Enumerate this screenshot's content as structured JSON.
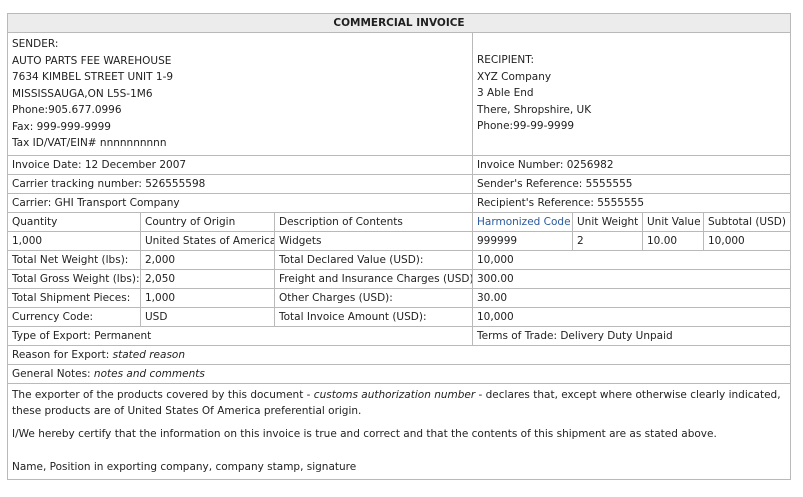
{
  "title": "COMMERCIAL INVOICE",
  "sender": {
    "lines": [
      "SENDER:",
      "AUTO PARTS FEE WAREHOUSE",
      "7634 KIMBEL STREET UNIT 1-9",
      "MISSISSAUGA,ON L5S-1M6",
      "Phone:905.677.0996",
      "Fax: 999-999-9999",
      "Tax ID/VAT/EIN# nnnnnnnnnn"
    ]
  },
  "recipient": {
    "lines": [
      "RECIPIENT:",
      "XYZ Company",
      "3 Able End",
      "There, Shropshire, UK",
      "Phone:99-99-9999"
    ]
  },
  "info": {
    "invoice_date": "Invoice Date: 12 December 2007",
    "invoice_number": "Invoice Number: 0256982",
    "carrier_tracking": "Carrier tracking number: 526555598",
    "sender_reference": "Sender's Reference: 5555555",
    "carrier": "Carrier: GHI Transport Company",
    "recipient_reference": "Recipient's Reference: 5555555"
  },
  "items": {
    "headers": {
      "quantity": "Quantity",
      "country": "Country of Origin",
      "description": "Description of Contents",
      "harmonized": "Harmonized Code",
      "unit_weight": "Unit Weight",
      "unit_value": "Unit Value",
      "subtotal": "Subtotal (USD)"
    },
    "row": {
      "quantity": "1,000",
      "country": "United States of America",
      "description": "Widgets",
      "harmonized": "999999",
      "unit_weight": "2",
      "unit_value": "10.00",
      "subtotal": "10,000"
    }
  },
  "totals": {
    "net_weight_label": "Total Net Weight (lbs):",
    "net_weight_value": "2,000",
    "declared_value_label": "Total Declared Value (USD):",
    "declared_value_value": "10,000",
    "gross_weight_label": "Total Gross Weight (lbs):",
    "gross_weight_value": "2,050",
    "freight_label": "Freight and Insurance Charges (USD):",
    "freight_value": "300.00",
    "shipment_pieces_label": "Total Shipment Pieces:",
    "shipment_pieces_value": "1,000",
    "other_charges_label": "Other Charges (USD):",
    "other_charges_value": "30.00",
    "currency_label": "Currency Code:",
    "currency_value": "USD",
    "invoice_amount_label": "Total Invoice Amount (USD):",
    "invoice_amount_value": "10,000"
  },
  "export": {
    "type": "Type of Export: Permanent",
    "terms": "Terms of Trade: Delivery Duty Unpaid",
    "reason_label": "Reason for Export: ",
    "reason_value": "stated reason",
    "notes_label": "General Notes: ",
    "notes_value": "notes and comments"
  },
  "declaration": {
    "part1": "The exporter of the products covered by this document - ",
    "auth_number": "customs authorization number",
    "part2": " - declares that, except where otherwise clearly indicated, these products are of United States Of America preferential origin.",
    "certify": "I/We hereby certify that the information on this invoice is true and correct and that the contents of this shipment are as stated above.",
    "signature": "Name, Position in exporting company, company stamp, signature"
  }
}
